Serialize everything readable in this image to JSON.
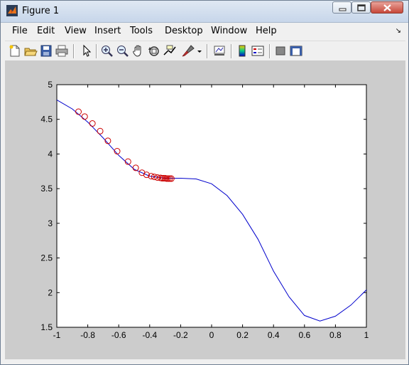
{
  "window": {
    "title": "Figure 1",
    "controls": [
      "minimize",
      "maximize",
      "close"
    ]
  },
  "menu": [
    "File",
    "Edit",
    "View",
    "Insert",
    "Tools",
    "Desktop",
    "Window",
    "Help"
  ],
  "toolbar": {
    "buttons": [
      "new-figure-icon",
      "open-file-icon",
      "save-icon",
      "print-icon",
      "pointer-icon",
      "zoom-in-icon",
      "zoom-out-icon",
      "pan-hand-icon",
      "rotate-3d-icon",
      "data-cursor-icon",
      "brush-icon",
      "link-plot-icon",
      "colorbar-icon",
      "legend-icon",
      "hide-plot-tools-icon",
      "show-plot-tools-icon"
    ]
  },
  "chart_data": {
    "type": "line",
    "xlim": [
      -1,
      1
    ],
    "ylim": [
      1.5,
      5
    ],
    "xticks": [
      "-1",
      "-0.8",
      "-0.6",
      "-0.4",
      "-0.2",
      "0",
      "0.2",
      "0.4",
      "0.6",
      "0.8",
      "1"
    ],
    "yticks": [
      "1.5",
      "2",
      "2.5",
      "3",
      "3.5",
      "4",
      "4.5",
      "5"
    ],
    "grid": false,
    "series": [
      {
        "style": "line",
        "color": "#0000cc",
        "x": [
          -1,
          -0.9,
          -0.8,
          -0.7,
          -0.6,
          -0.5,
          -0.4,
          -0.3,
          -0.2,
          -0.1,
          0,
          0.1,
          0.2,
          0.3,
          0.4,
          0.5,
          0.6,
          0.7,
          0.8,
          0.9,
          1
        ],
        "y": [
          4.78,
          4.65,
          4.46,
          4.23,
          3.98,
          3.78,
          3.68,
          3.65,
          3.65,
          3.64,
          3.57,
          3.4,
          3.13,
          2.77,
          2.31,
          1.94,
          1.67,
          1.59,
          1.66,
          1.82,
          2.04
        ]
      },
      {
        "style": "markers",
        "marker": "circle",
        "color": "#cc0000",
        "x": [
          -0.86,
          -0.82,
          -0.77,
          -0.72,
          -0.67,
          -0.61,
          -0.54,
          -0.49,
          -0.45,
          -0.42,
          -0.39,
          -0.37,
          -0.35,
          -0.33,
          -0.32,
          -0.31,
          -0.3,
          -0.29,
          -0.28,
          -0.27,
          -0.26
        ],
        "y": [
          4.61,
          4.54,
          4.44,
          4.33,
          4.19,
          4.04,
          3.89,
          3.8,
          3.73,
          3.7,
          3.68,
          3.67,
          3.66,
          3.655,
          3.65,
          3.65,
          3.65,
          3.645,
          3.645,
          3.645,
          3.645
        ]
      }
    ]
  }
}
